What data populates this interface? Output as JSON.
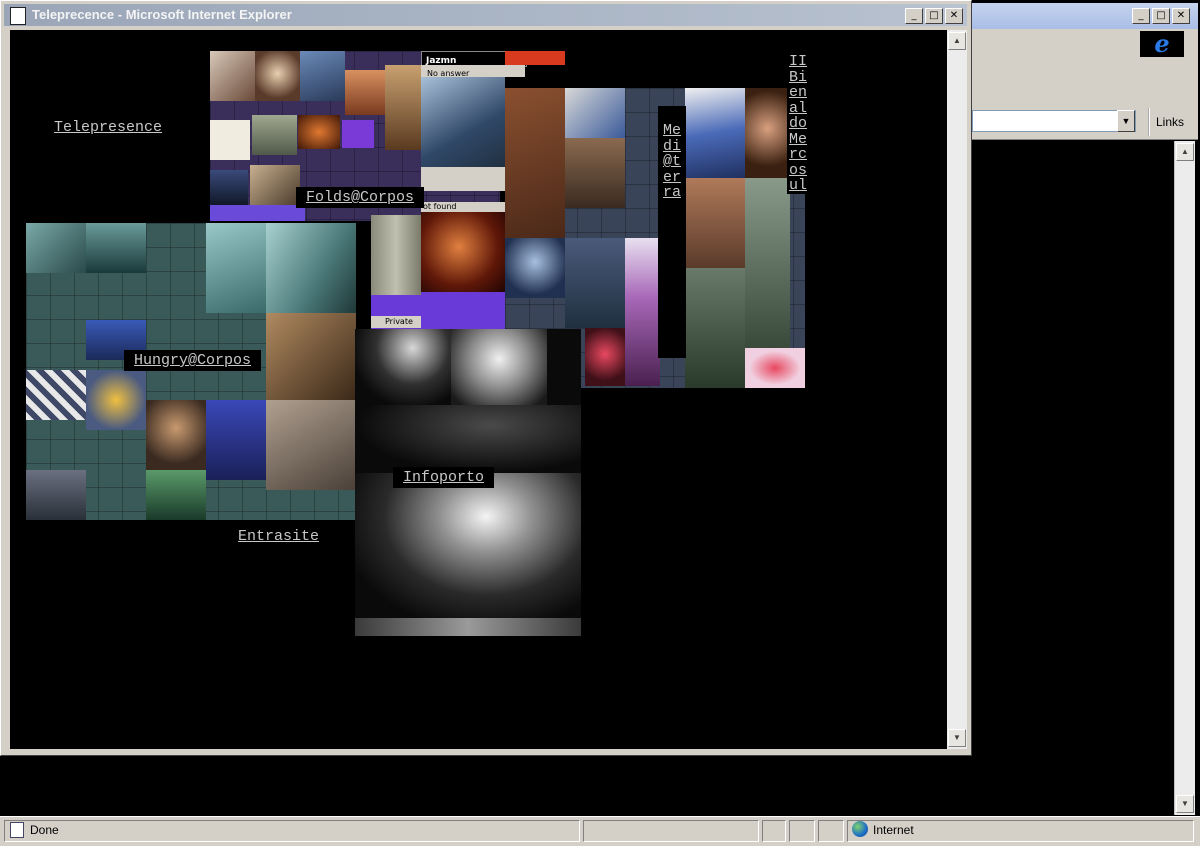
{
  "background_window": {
    "toolbar": {
      "links_label": "Links"
    },
    "statusbar": {
      "status_text": "Done",
      "zone_text": "Internet"
    }
  },
  "popup": {
    "title": "Teleprecence - Microsoft Internet Explorer",
    "links": {
      "telepresence": "Telepresence",
      "folds_corpos": "Folds@Corpos",
      "hungry_corpos": "Hungry@Corpos",
      "entrasite": "Entrasite",
      "infoporto": "Infoporto",
      "mediaterra": "Medi@terra",
      "bienal": "II Bienal do Mercosul"
    },
    "chat_window": {
      "name": "Jazmn",
      "status": "No answer",
      "not_found": "ot found",
      "private": "Private"
    }
  },
  "icons": {
    "minimize": "minimize-icon",
    "maximize": "maximize-icon",
    "close": "close-icon",
    "ie_logo": "ie-logo-icon",
    "globe": "globe-icon"
  }
}
